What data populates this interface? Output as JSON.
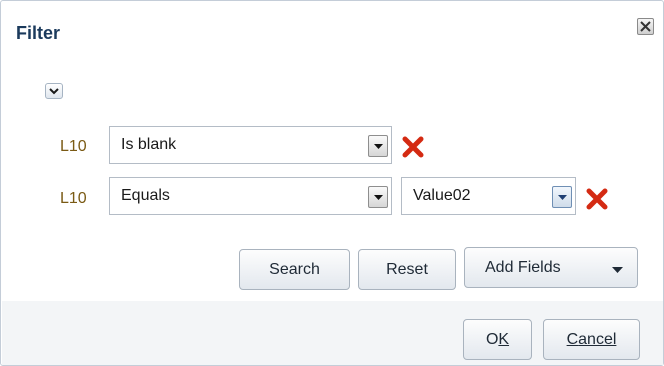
{
  "dialog": {
    "title": "Filter",
    "close_icon": "close-icon"
  },
  "toggle": {
    "icon": "chevron-down-icon"
  },
  "rows": [
    {
      "label": "L10",
      "operator": "Is blank",
      "value": null
    },
    {
      "label": "L10",
      "operator": "Equals",
      "value": "Value02"
    }
  ],
  "actions": {
    "search": "Search",
    "reset": "Reset",
    "add_fields": "Add Fields"
  },
  "footer": {
    "ok": "OK",
    "ok_mnemonic": "K",
    "ok_prefix": "O",
    "cancel": "Cancel",
    "cancel_mnemonic": "C",
    "cancel_rest": "ancel"
  },
  "colors": {
    "title": "#1b3a5c",
    "label": "#7a5a14",
    "delete": "#d42a12"
  }
}
